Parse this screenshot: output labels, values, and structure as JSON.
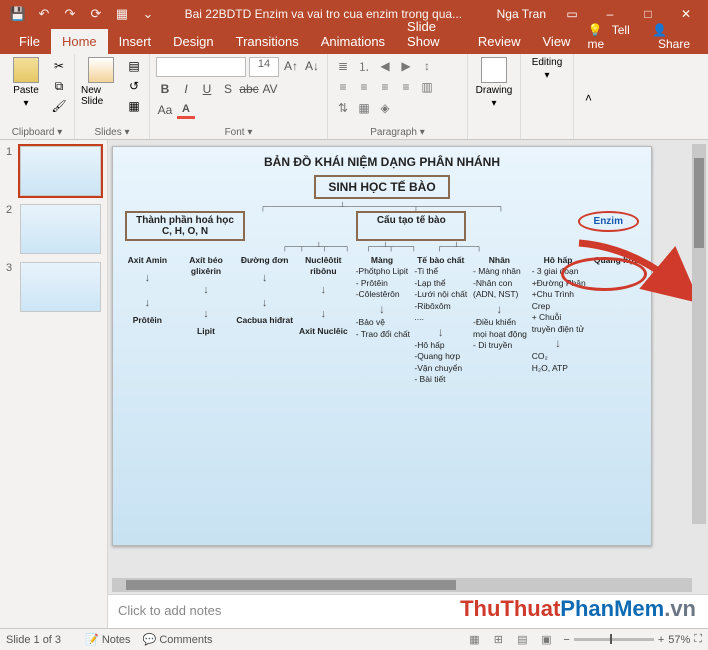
{
  "title": {
    "doc": "Bai 22BDTD Enzim va vai tro cua enzim trong qua...",
    "user": "Nga Tran"
  },
  "qat": [
    "💾",
    "↶",
    "↷",
    "⟳",
    "▦",
    "⌄"
  ],
  "wincontrols": [
    "▭",
    "–",
    "□",
    "✕"
  ],
  "tabs": [
    "File",
    "Home",
    "Insert",
    "Design",
    "Transitions",
    "Animations",
    "Slide Show",
    "Review",
    "View"
  ],
  "tabright": {
    "tellme": "Tell me",
    "share": "Share"
  },
  "ribbon": {
    "clipboard": {
      "label": "Clipboard",
      "paste": "Paste"
    },
    "slides": {
      "label": "Slides",
      "new": "New Slide"
    },
    "font": {
      "label": "Font",
      "size": "14",
      "b": "B",
      "i": "I",
      "u": "U",
      "s": "S",
      "abc": "abc",
      "AV": "AV",
      "Aa": "Aa",
      "A": "A"
    },
    "para": {
      "label": "Paragraph"
    },
    "drawing": {
      "label": "Drawing"
    },
    "editing": {
      "label": "Editing"
    }
  },
  "thumbs": [
    "1",
    "2",
    "3"
  ],
  "slide": {
    "title": "BẢN ĐỒ KHÁI NIỆM DẠNG PHÂN NHÁNH",
    "root": "SINH HỌC TẾ BÀO",
    "l2a": "Thành phần hoá học C, H, O, N",
    "l2b": "Cấu tạo tế bào",
    "l2c": "Enzim",
    "cols": [
      {
        "head": "Axit Amin",
        "low": "Prôtêin"
      },
      {
        "head": "Axít béo glixêrin",
        "low": "Lipit"
      },
      {
        "head": "Đường đơn",
        "low": "Cacbua hiđrat"
      },
      {
        "head": "Nuclêôtit ribônu",
        "low": "Axit Nuclêic"
      },
      {
        "head": "Màng",
        "body": "-Phốtpho Lipit\n- Prôtêin\n-Côlestêrôn",
        "low": "-Bảo vệ\n- Trao đổi chất"
      },
      {
        "head": "Tế bào chất",
        "body": "-Ti thể\n-Lạp thể\n-Lưới nội chất\n-Ribôxôm\n....",
        "low": "-Hô hấp\n-Quang hợp\n-Vận chuyển\n- Bài tiết"
      },
      {
        "head": "Nhân",
        "body": "- Màng nhân\n-Nhân con\n(ADN, NST)",
        "low": "-Điều khiển mọi hoạt động\n- Di truyền"
      },
      {
        "head": "Hô hấp",
        "body": "- 3 giai đoạn\n+Đường Phân\n+Chu Trình Crep\n+ Chuỗi truyền điện tử",
        "low": "CO₂\nH₂O, ATP"
      },
      {
        "head": "Quang hợp"
      }
    ]
  },
  "notes": "Click to add notes",
  "status": {
    "slide": "Slide 1 of 3",
    "lang": "",
    "notes": "Notes",
    "comments": "Comments",
    "zoom": "57%"
  }
}
